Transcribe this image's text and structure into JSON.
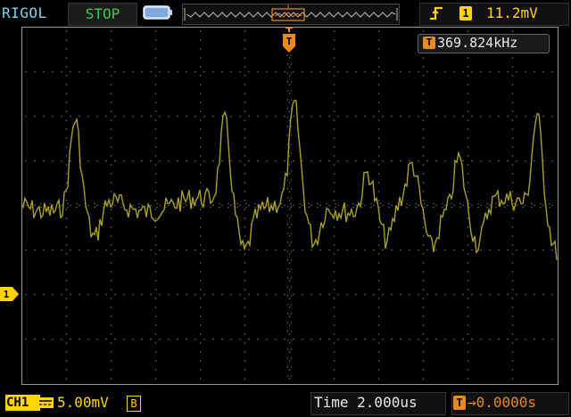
{
  "top_bar": {
    "brand": "RIGOL",
    "run_status": "STOP",
    "trigger": {
      "edge_icon": "rising-edge-icon",
      "source": "1",
      "level": "11.2mV"
    }
  },
  "display": {
    "frequency_marker": "T",
    "frequency": "369.824kHz",
    "trigger_position_marker": "T",
    "channel_marker": "1"
  },
  "bottom_bar": {
    "channel": "CH1",
    "scale": "5.00mV",
    "bw_limit": "B",
    "timebase": "Time 2.000us",
    "offset_marker": "T",
    "offset": "→0.0000s"
  },
  "colors": {
    "channel1": "#ffd400",
    "trace": "#a8a020",
    "trigger": "#e98a1e",
    "run_status": "#2ed13a",
    "brand": "#7fd3f0",
    "grid": "#808080"
  }
}
